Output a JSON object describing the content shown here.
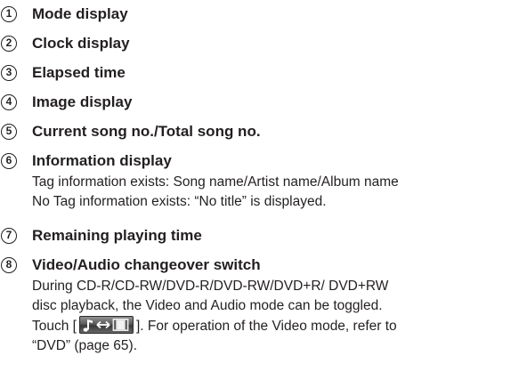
{
  "items": [
    {
      "number": "1",
      "title": "Mode display"
    },
    {
      "number": "2",
      "title": "Clock display"
    },
    {
      "number": "3",
      "title": "Elapsed time"
    },
    {
      "number": "4",
      "title": "Image display"
    },
    {
      "number": "5",
      "title": "Current song no./Total song no."
    },
    {
      "number": "6",
      "title": "Information display",
      "lines": [
        "Tag information exists: Song name/Artist name/Album name",
        "No Tag information exists: “No title” is displayed."
      ]
    },
    {
      "number": "7",
      "title": "Remaining playing time"
    },
    {
      "number": "8",
      "title": "Video/Audio changeover switch",
      "lines": [
        "During CD-R/CD-RW/DVD-R/DVD-RW/DVD+R/ DVD+RW",
        "disc playback, the Video and Audio mode can be toggled.",
        "Touch [",
        "]. For operation of the Video mode, refer to",
        "“DVD” (page 65)."
      ]
    }
  ],
  "icons": {
    "switch_icon": "music-video-toggle-icon"
  }
}
